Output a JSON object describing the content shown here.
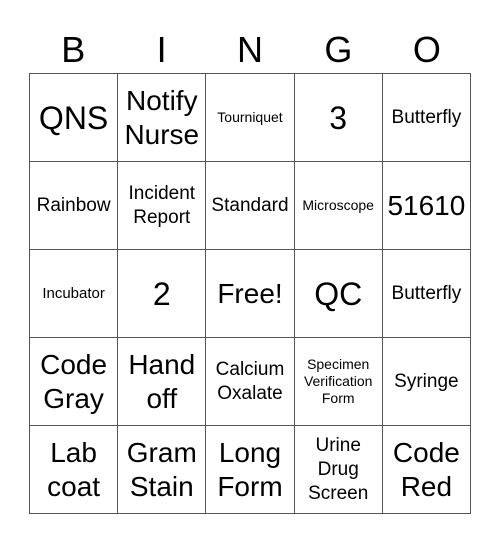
{
  "header": [
    "B",
    "I",
    "N",
    "G",
    "O"
  ],
  "cells": [
    {
      "text": "QNS",
      "size": "s-xl"
    },
    {
      "text": "Notify Nurse",
      "size": "s-lg"
    },
    {
      "text": "Tourniquet",
      "size": "s-xxs"
    },
    {
      "text": "3",
      "size": "s-xl"
    },
    {
      "text": "Butterfly",
      "size": "s-md"
    },
    {
      "text": "Rainbow",
      "size": "s-md"
    },
    {
      "text": "Incident Report",
      "size": "s-md"
    },
    {
      "text": "Standard",
      "size": "s-md"
    },
    {
      "text": "Microscope",
      "size": "s-xxs"
    },
    {
      "text": "51610",
      "size": "s-lg"
    },
    {
      "text": "Incubator",
      "size": "s-xs"
    },
    {
      "text": "2",
      "size": "s-xl"
    },
    {
      "text": "Free!",
      "size": "s-lg"
    },
    {
      "text": "QC",
      "size": "s-xl"
    },
    {
      "text": "Butterfly",
      "size": "s-md"
    },
    {
      "text": "Code Gray",
      "size": "s-lg"
    },
    {
      "text": "Hand off",
      "size": "s-lg"
    },
    {
      "text": "Calcium Oxalate",
      "size": "s-md"
    },
    {
      "text": "Specimen Verification Form",
      "size": "s-xxs"
    },
    {
      "text": "Syringe",
      "size": "s-md"
    },
    {
      "text": "Lab coat",
      "size": "s-lg"
    },
    {
      "text": "Gram Stain",
      "size": "s-lg"
    },
    {
      "text": "Long Form",
      "size": "s-lg"
    },
    {
      "text": "Urine Drug Screen",
      "size": "s-md"
    },
    {
      "text": "Code Red",
      "size": "s-lg"
    }
  ]
}
